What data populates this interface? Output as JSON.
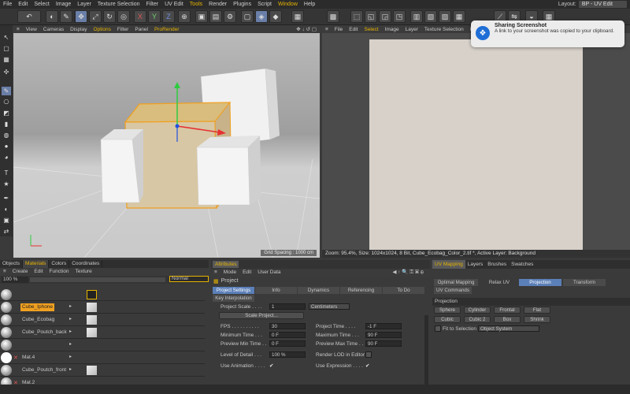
{
  "menu": {
    "items": [
      "File",
      "Edit",
      "Select",
      "Image",
      "Layer",
      "Texture Selection",
      "Filter",
      "UV Edit",
      "Tools",
      "Render",
      "Plugins",
      "Script",
      "Window",
      "Help"
    ],
    "layout_label": "Layout:",
    "layout_value": "BP - UV Edit"
  },
  "viewport": {
    "menu": [
      "View",
      "Cameras",
      "Display",
      "Options",
      "Filter",
      "Panel",
      "ProRender"
    ],
    "grid_spacing": "Grid Spacing : 1000 cm"
  },
  "uv_editor": {
    "menu": [
      "File",
      "Edit",
      "Select",
      "Image",
      "Layer",
      "Texture Selection",
      "Filter"
    ],
    "status": "Zoom: 95.4%, Size: 1024x1024, 8 Bit, Cube_Ecobag_Color_2.tif *, Active Layer: Background"
  },
  "notification": {
    "title": "Sharing Screenshot",
    "body": "A link to your screenshot was copied to your clipboard."
  },
  "materials": {
    "tabs": [
      "Objects",
      "Materials",
      "Colors",
      "Coordinates"
    ],
    "active_tab": "Materials",
    "menu": [
      "Create",
      "Edit",
      "Function",
      "Texture"
    ],
    "zoom": "100 %",
    "blend_mode": "Normal",
    "rows": [
      {
        "name": "",
        "tag": false,
        "selected": false
      },
      {
        "name": "Cube_Iphone",
        "tag": false,
        "selected": true
      },
      {
        "name": "Cube_Ecobag",
        "tag": false,
        "selected": false
      },
      {
        "name": "Cube_Poutch_back",
        "tag": false,
        "selected": false
      },
      {
        "name": "",
        "tag": false,
        "selected": false
      },
      {
        "name": "Mat.4",
        "tag": true,
        "selected": false
      },
      {
        "name": "Cube_Poutch_front",
        "tag": false,
        "selected": false
      },
      {
        "name": "Mat.2",
        "tag": true,
        "selected": false
      }
    ]
  },
  "attributes": {
    "tab": "Attributes",
    "menu": [
      "Mode",
      "Edit",
      "User Data"
    ],
    "section": "Project",
    "tabs": [
      "Project Settings",
      "Info",
      "Dynamics",
      "Referencing",
      "To Do",
      "Key Interpolation"
    ],
    "active_tab": "Project Settings",
    "project_scale_label": "Project Scale . . . .",
    "project_scale_value": "1",
    "project_scale_unit": "Centimeters",
    "scale_button": "Scale Project...",
    "fps_label": "FPS . . . . . . . . . .",
    "fps_value": "30",
    "project_time_label": "Project Time . . . .",
    "project_time_value": "-1 F",
    "min_time_label": "Minimum Time . . .",
    "min_time_value": "0 F",
    "max_time_label": "Maximum Time . . .",
    "max_time_value": "90 F",
    "prev_min_label": "Preview Min Time . .",
    "prev_min_value": "0 F",
    "prev_max_label": "Preview Max Time . .",
    "prev_max_value": "90 F",
    "lod_label": "Level of Detail . . .",
    "lod_value": "100 %",
    "render_lod_label": "Render LOD in Editor",
    "use_anim_label": "Use Animation . . . .",
    "use_expr_label": "Use Expression . . . ."
  },
  "uv_panel": {
    "tabs": [
      "UV Mapping",
      "Layers",
      "Brushes",
      "Swatches"
    ],
    "active_tab": "UV Mapping",
    "sub_tabs": [
      "Optimal Mapping",
      "Relax UV",
      "Projection",
      "Transform",
      "UV Commands"
    ],
    "active_sub": "Projection",
    "section": "Projection",
    "buttons": [
      "Sphere",
      "Cylinder",
      "Frontal",
      "Flat",
      "Cubic",
      "Cubic 2",
      "Box",
      "Shrink"
    ],
    "fit_label": "Fit to Selection",
    "fit_value": "Object System"
  },
  "colors": {
    "accent": "#e8b400",
    "selected_tab": "#5b7fb8",
    "material_highlight": "#f0a020"
  }
}
